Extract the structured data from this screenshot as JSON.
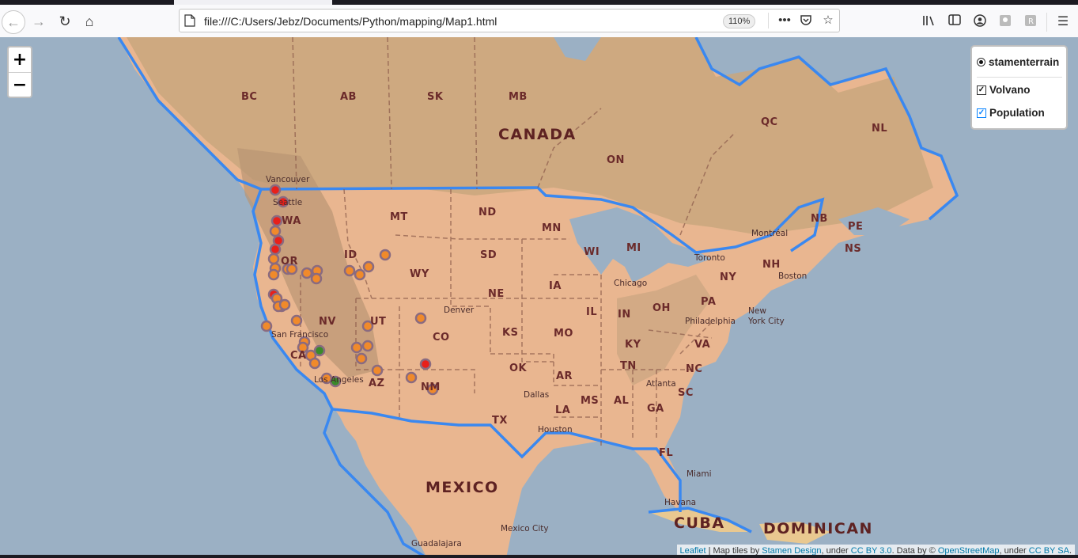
{
  "browser": {
    "url": "file:///C:/Users/Jebz/Documents/Python/mapping/Map1.html",
    "zoom_level": "110%",
    "nav_icons": [
      "back-icon",
      "forward-icon",
      "reload-icon",
      "home-icon"
    ],
    "toolbar_icons": [
      "library-icon",
      "sidebar-icon",
      "account-icon",
      "extension-icon",
      "extension-icon-2",
      "menu-icon"
    ]
  },
  "map": {
    "zoom_in": "+",
    "zoom_out": "−",
    "layers": {
      "base": "stamenterrain",
      "overlays": [
        {
          "label": "Volvano",
          "checked": true
        },
        {
          "label": "Population",
          "checked": true
        }
      ]
    },
    "region_labels": [
      "CANADA",
      "MEXICO",
      "CUBA",
      "DOMINICAN"
    ],
    "state_labels": [
      "BC",
      "AB",
      "SK",
      "MB",
      "ON",
      "QC",
      "NL",
      "WA",
      "OR",
      "ID",
      "MT",
      "ND",
      "MN",
      "WI",
      "MI",
      "SD",
      "WY",
      "NE",
      "IA",
      "IL",
      "IN",
      "OH",
      "PA",
      "NY",
      "NV",
      "UT",
      "CO",
      "KS",
      "MO",
      "KY",
      "CA",
      "AZ",
      "NM",
      "OK",
      "AR",
      "TN",
      "VA",
      "NC",
      "SC",
      "AL",
      "GA",
      "MS",
      "LA",
      "TX",
      "FL",
      "NB",
      "NS",
      "PE",
      "NH"
    ],
    "city_labels": [
      "Vancouver",
      "Seattle",
      "Denver",
      "Chicago",
      "Toronto",
      "Montréal",
      "Boston",
      "New York City",
      "Philadelphia",
      "Atlanta",
      "Dallas",
      "Houston",
      "Miami",
      "Havana",
      "San Francisco",
      "Los Angeles",
      "Mexico City",
      "Guadalajara"
    ],
    "colors": {
      "high": "#e8201a",
      "mid": "#f08a2b",
      "low": "#3a8a2a",
      "marker_stroke": "#8a6b80",
      "boundary": "#3a88f0",
      "water": "#9bb0c4",
      "land": "#e9b690"
    },
    "attribution": {
      "leaflet": "Leaflet",
      "t1": " | Map tiles by ",
      "stamen": "Stamen Design",
      "t2": ", under ",
      "ccby": "CC BY 3.0",
      "t3": ". Data by © ",
      "osm": "OpenStreetMap",
      "t4": ", under ",
      "ccbysa": "CC BY SA",
      "t5": "."
    }
  }
}
